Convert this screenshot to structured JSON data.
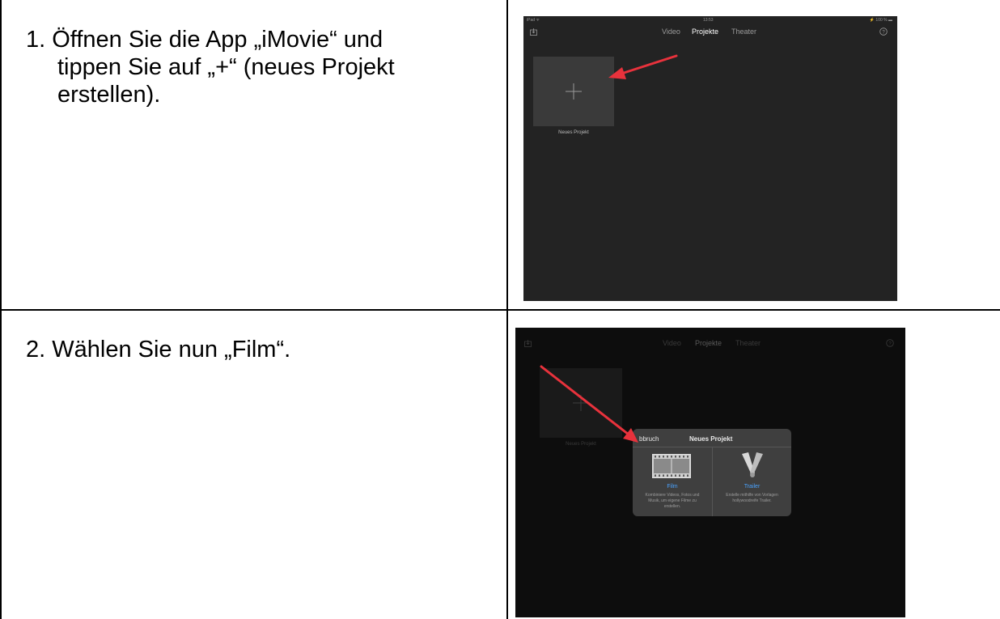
{
  "steps": [
    {
      "text_lines": [
        "1. Öffnen Sie die App „iMovie“ und",
        "tippen Sie auf „+“ (neues Projekt",
        "erstellen)."
      ],
      "screenshot": {
        "status": {
          "left": "iPad ᯤ",
          "time": "13:53",
          "right": "⚡ 100 % ▬"
        },
        "tabs": {
          "video": "Video",
          "projects": "Projekte",
          "theater": "Theater"
        },
        "tile_label": "Neues Projekt"
      }
    },
    {
      "text_lines": [
        "2. Wählen Sie nun „Film“."
      ],
      "screenshot": {
        "tabs": {
          "video": "Video",
          "projects": "Projekte",
          "theater": "Theater"
        },
        "tile_label": "Neues Projekt",
        "dialog": {
          "cancel": "bbruch",
          "title": "Neues Projekt",
          "film": {
            "title": "Film",
            "desc_lines": [
              "Kombiniere Videos, Fotos und",
              "Musik, um eigene Filme zu",
              "erstellen."
            ]
          },
          "trailer": {
            "title": "Trailer",
            "desc_lines": [
              "Erstelle mithilfe von Vorlagen",
              "hollywoodreife Trailer."
            ]
          }
        }
      }
    }
  ],
  "colors": {
    "arrow": "#e8323c",
    "accent": "#4aa3ff",
    "app_bg": "#232323"
  }
}
